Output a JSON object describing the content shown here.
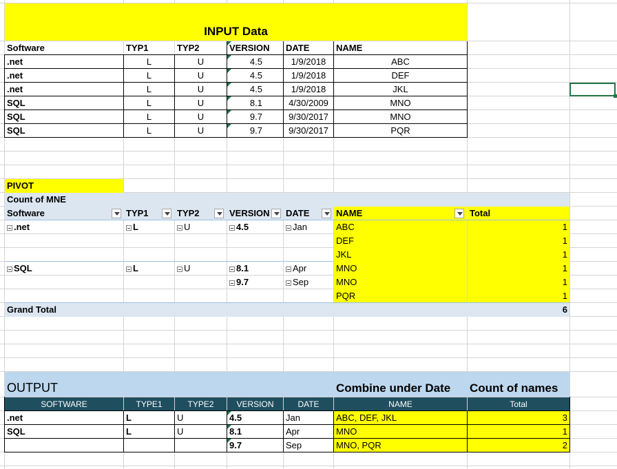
{
  "input": {
    "title": "INPUT Data",
    "headers": [
      "Software",
      "TYP1",
      "TYP2",
      "VERSION",
      "DATE",
      "NAME"
    ],
    "rows": [
      [
        ".net",
        "L",
        "U",
        "4.5",
        "1/9/2018",
        "ABC"
      ],
      [
        ".net",
        "L",
        "U",
        "4.5",
        "1/9/2018",
        "DEF"
      ],
      [
        ".net",
        "L",
        "U",
        "4.5",
        "1/9/2018",
        "JKL"
      ],
      [
        "SQL",
        "L",
        "U",
        "8.1",
        "4/30/2009",
        "MNO"
      ],
      [
        "SQL",
        "L",
        "U",
        "9.7",
        "9/30/2017",
        "MNO"
      ],
      [
        "SQL",
        "L",
        "U",
        "9.7",
        "9/30/2017",
        "PQR"
      ]
    ]
  },
  "pivot": {
    "title": "PIVOT",
    "measure": "Count of MNE",
    "headers": [
      "Software",
      "TYP1",
      "TYP2",
      "VERSION",
      "DATE",
      "NAME",
      "Total"
    ],
    "rows": [
      {
        "software": ".net",
        "typ1": "L",
        "typ2": "U",
        "version": "4.5",
        "date": "Jan",
        "name": "ABC",
        "total": "1"
      },
      {
        "software": "",
        "typ1": "",
        "typ2": "",
        "version": "",
        "date": "",
        "name": "DEF",
        "total": "1"
      },
      {
        "software": "",
        "typ1": "",
        "typ2": "",
        "version": "",
        "date": "",
        "name": "JKL",
        "total": "1"
      },
      {
        "software": "SQL",
        "typ1": "L",
        "typ2": "U",
        "version": "8.1",
        "date": "Apr",
        "name": "MNO",
        "total": "1"
      },
      {
        "software": "",
        "typ1": "",
        "typ2": "",
        "version": "9.7",
        "date": "Sep",
        "name": "MNO",
        "total": "1"
      },
      {
        "software": "",
        "typ1": "",
        "typ2": "",
        "version": "",
        "date": "",
        "name": "PQR",
        "total": "1"
      }
    ],
    "grand_total_label": "Grand Total",
    "grand_total_value": "6"
  },
  "output": {
    "title": "OUTPUT",
    "note_combine": "Combine under Date",
    "note_count": "Count of names",
    "headers": [
      "SOFTWARE",
      "TYPE1",
      "TYPE2",
      "VERSION",
      "DATE",
      "NAME",
      "Total"
    ],
    "rows": [
      [
        ".net",
        "L",
        "U",
        "4.5",
        "Jan",
        "ABC, DEF, JKL",
        "3"
      ],
      [
        "SQL",
        "L",
        "U",
        "8.1",
        "Apr",
        "MNO",
        "1"
      ],
      [
        "",
        "",
        "",
        "9.7",
        "Sep",
        "MNO, PQR",
        "2"
      ]
    ]
  },
  "colors": {
    "highlight": "#ffff00",
    "pivot_header": "#dce6f1",
    "output_header": "#1f4e5f",
    "selection": "#217346"
  }
}
